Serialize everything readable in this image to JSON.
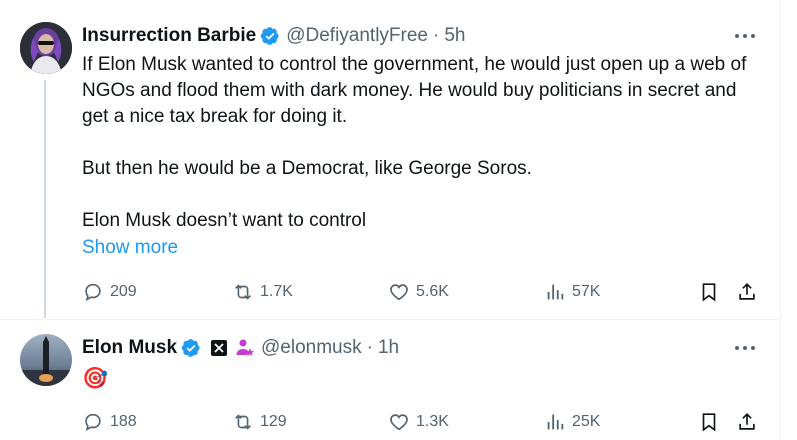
{
  "tweets": [
    {
      "author_name": "Insurrection Barbie",
      "handle": "@DefiyantlyFree",
      "separator": "·",
      "time": "5h",
      "text": "If Elon Musk wanted to control the government, he would just open up a web of NGOs and flood them with dark money. He would buy politicians in secret and get a nice tax break for doing it.\n\nBut then he would be a Democrat, like George Soros.\n\nElon Musk doesn’t want to control",
      "show_more": "Show more",
      "replies": "209",
      "reposts": "1.7K",
      "likes": "5.6K",
      "views": "57K"
    },
    {
      "author_name": "Elon Musk",
      "handle": "@elonmusk",
      "separator": "·",
      "time": "1h",
      "text": "🎯",
      "replies": "188",
      "reposts": "129",
      "likes": "1.3K",
      "views": "25K"
    }
  ],
  "colors": {
    "accent": "#1d9bf0",
    "secondary_text": "#536471",
    "divider": "#eff3f4"
  },
  "icons": [
    "verified-badge-icon",
    "more-icon",
    "reply-icon",
    "repost-icon",
    "like-icon",
    "views-icon",
    "bookmark-icon",
    "share-icon",
    "x-affiliate-icon",
    "government-official-icon"
  ]
}
